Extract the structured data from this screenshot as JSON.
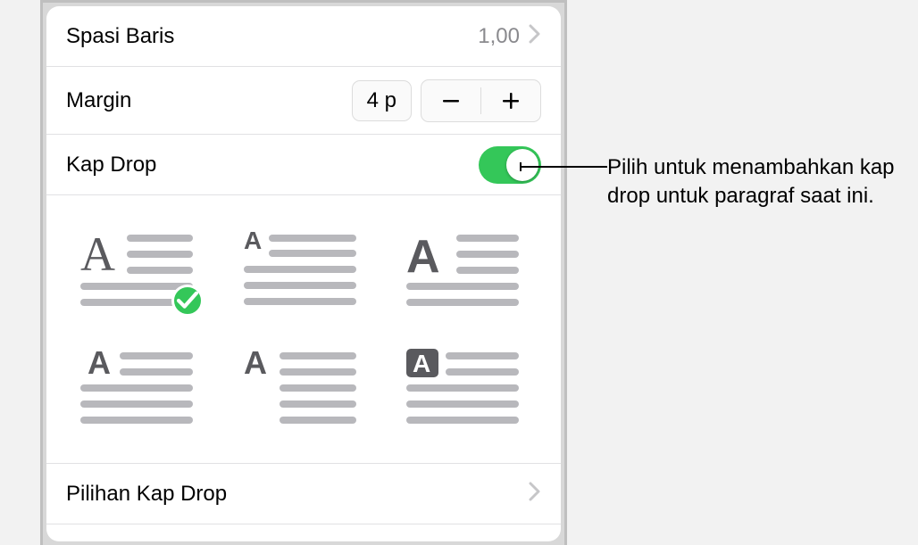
{
  "rows": {
    "lineSpacing": {
      "label": "Spasi Baris",
      "value": "1,00"
    },
    "margin": {
      "label": "Margin",
      "value": "4 p"
    },
    "dropCap": {
      "label": "Kap Drop",
      "enabled": true
    },
    "dropCapOptions": {
      "label": "Pilihan Kap Drop"
    }
  },
  "styles": {
    "selectedIndex": 0,
    "options": [
      {
        "id": "dropcap-style-1"
      },
      {
        "id": "dropcap-style-2"
      },
      {
        "id": "dropcap-style-3"
      },
      {
        "id": "dropcap-style-4"
      },
      {
        "id": "dropcap-style-5"
      },
      {
        "id": "dropcap-style-6"
      }
    ]
  },
  "callout": {
    "text": "Pilih untuk menambahkan kap drop untuk paragraf saat ini."
  }
}
